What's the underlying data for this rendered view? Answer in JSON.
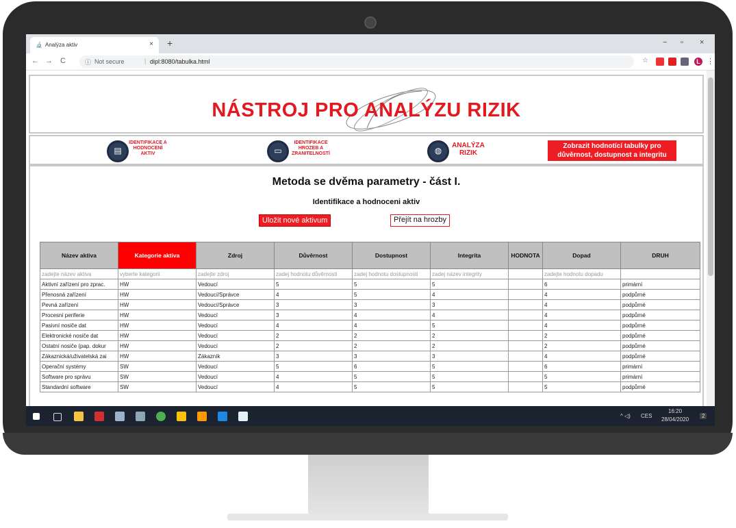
{
  "browser": {
    "tab_title": "Analýza aktiv",
    "tab_icon": "🔬",
    "close_tab": "×",
    "new_tab": "+",
    "url_prefix": "Not secure",
    "url_separator": "|",
    "url": "dipl:8080/tabulka.html",
    "nav_back": "←",
    "nav_forward": "→",
    "nav_reload": "C",
    "info_icon": "ⓘ",
    "star": "☆",
    "win_min": "−",
    "win_max": "▫",
    "win_close": "×",
    "menu": "⋮",
    "avatar": "L"
  },
  "header": {
    "title": "NÁSTROJ PRO ANALÝZU RIZIK"
  },
  "nav": {
    "item1_label": "IDENTIFIKACE A HODNOCENÍ AKTIV",
    "item2_label": "IDENTIFIKACE HROZEB A ZRANITELNOSTÍ",
    "item3_label": "ANALÝZA RIZIK",
    "tables_button_line1": "Zobrazit hodnotící tabulky pro",
    "tables_button_line2": "důvěrnost, dostupnost a integritu"
  },
  "main": {
    "heading": "Metoda se dvěma parametry - část I.",
    "subheading": "Identifikace a hodnoceni aktiv",
    "save_button": "Uložit nové aktivum",
    "go_button": "Přejít na hrozby"
  },
  "table": {
    "columns": [
      "Název aktiva",
      "Kategorie aktiva",
      "Zdroj",
      "Důvěrnost",
      "Dostupnost",
      "Integrita",
      "HODNOTA",
      "Dopad",
      "DRUH"
    ],
    "placeholders": [
      "zadejte název aktiva",
      "vyberte kategorii",
      "zadejte zdroj",
      "zadej hodnotu důvěrnosti",
      "zadej hodnotu dostupnosti",
      "zadej název integrity",
      "",
      "zadejte hodnotu dopadu",
      ""
    ],
    "rows": [
      [
        "Aktivní zařízení pro zprac.",
        "HW",
        "Vedoucí",
        "5",
        "5",
        "5",
        "",
        "6",
        "primární"
      ],
      [
        "Přenosná zařízení",
        "HW",
        "Vedoucí/Správce",
        "4",
        "5",
        "4",
        "",
        "4",
        "podpůrné"
      ],
      [
        "Pevná zařízení",
        "HW",
        "Vedoucí/Správce",
        "3",
        "3",
        "3",
        "",
        "4",
        "podpůrné"
      ],
      [
        "Procesní periferie",
        "HW",
        "Vedoucí",
        "3",
        "4",
        "4",
        "",
        "4",
        "podpůrné"
      ],
      [
        "Pasivní nosiče dat",
        "HW",
        "Vedoucí",
        "4",
        "4",
        "5",
        "",
        "4",
        "podpůrné"
      ],
      [
        "Elektronické nosiče dat",
        "HW",
        "Vedoucí",
        "2",
        "2",
        "2",
        "",
        "2",
        "podpůrné"
      ],
      [
        "Ostatní nosiče (pap. dokur",
        "HW",
        "Vedoucí",
        "2",
        "2",
        "2",
        "",
        "2",
        "podpůrné"
      ],
      [
        "Zákaznická/uživatelská zai",
        "HW",
        "Zákazník",
        "3",
        "3",
        "3",
        "",
        "4",
        "podpůrné"
      ],
      [
        "Operační systémy",
        "SW",
        "Vedoucí",
        "5",
        "6",
        "5",
        "",
        "6",
        "primární"
      ],
      [
        "Software pro správu",
        "SW",
        "Vedoucí",
        "4",
        "5",
        "5",
        "",
        "5",
        "primární"
      ],
      [
        "Standardní software",
        "SW",
        "Vedoucí",
        "4",
        "5",
        "5",
        "",
        "5",
        "podpůrné"
      ]
    ]
  },
  "taskbar": {
    "lang": "CES",
    "time": "16:20",
    "date": "28/04/2020",
    "notif_count": "2"
  }
}
